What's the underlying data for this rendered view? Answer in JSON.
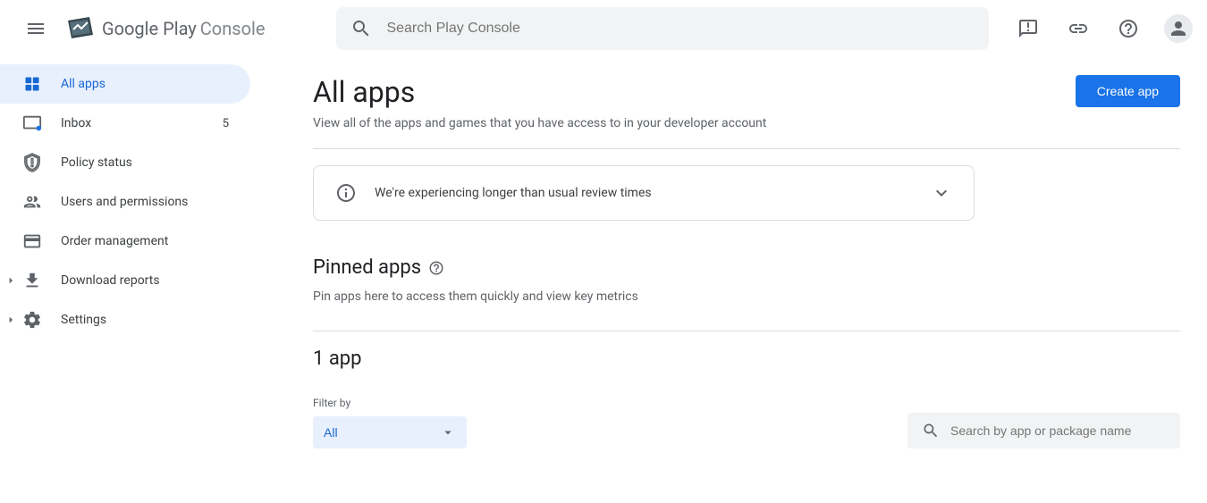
{
  "header": {
    "logo_text1": "Google Play",
    "logo_text2": "Console",
    "search_placeholder": "Search Play Console"
  },
  "sidebar": {
    "items": [
      {
        "label": "All apps",
        "badge": ""
      },
      {
        "label": "Inbox",
        "badge": "5"
      },
      {
        "label": "Policy status",
        "badge": ""
      },
      {
        "label": "Users and permissions",
        "badge": ""
      },
      {
        "label": "Order management",
        "badge": ""
      },
      {
        "label": "Download reports",
        "badge": ""
      },
      {
        "label": "Settings",
        "badge": ""
      }
    ]
  },
  "main": {
    "title": "All apps",
    "create_button": "Create app",
    "subtitle": "View all of the apps and games that you have access to in your developer account",
    "notice": "We're experiencing longer than usual review times",
    "pinned_title": "Pinned apps",
    "pinned_subtitle": "Pin apps here to access them quickly and view key metrics",
    "app_count": "1 app",
    "filter_label": "Filter by",
    "filter_value": "All",
    "app_search_placeholder": "Search by app or package name"
  }
}
